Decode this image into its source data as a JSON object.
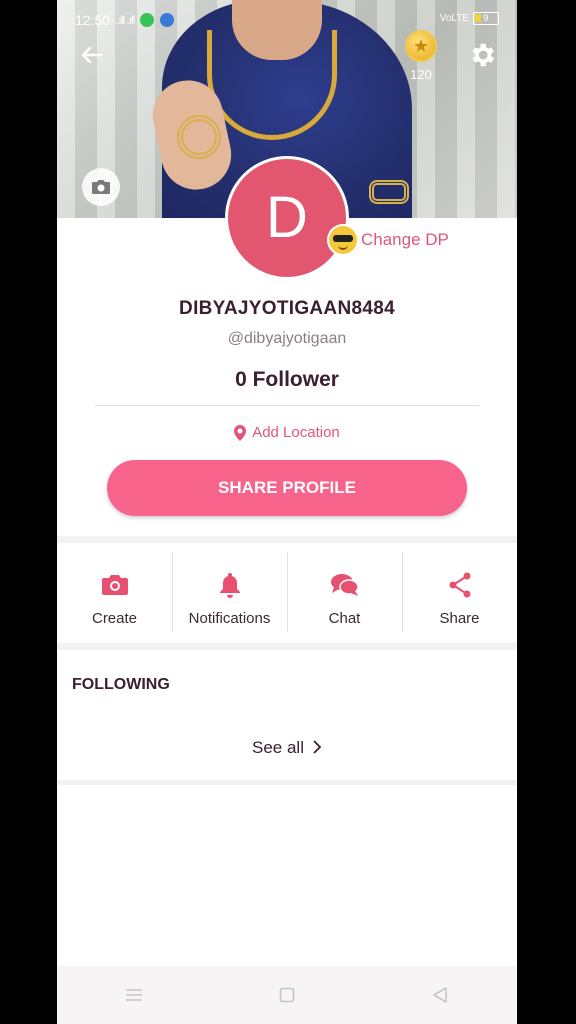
{
  "status_bar": {
    "time": "12:50",
    "network": "VoLTE",
    "battery": "9"
  },
  "header": {
    "coins": "120",
    "coin_symbol": "★"
  },
  "profile": {
    "avatar_letter": "D",
    "change_dp_label": "Change DP",
    "username": "DIBYAJYOTIGAAN8484",
    "handle": "@dibyajyotigaan",
    "followers": "0 Follower",
    "location_label": "Add Location",
    "share_button": "SHARE PROFILE"
  },
  "actions": [
    {
      "label": "Create",
      "icon": "camera-icon"
    },
    {
      "label": "Notifications",
      "icon": "bell-icon"
    },
    {
      "label": "Chat",
      "icon": "chat-icon"
    },
    {
      "label": "Share",
      "icon": "share-icon"
    }
  ],
  "following": {
    "title": "FOLLOWING",
    "see_all": "See all"
  },
  "colors": {
    "accent": "#f7638a",
    "avatar": "#e35670",
    "text": "#3a2030"
  }
}
